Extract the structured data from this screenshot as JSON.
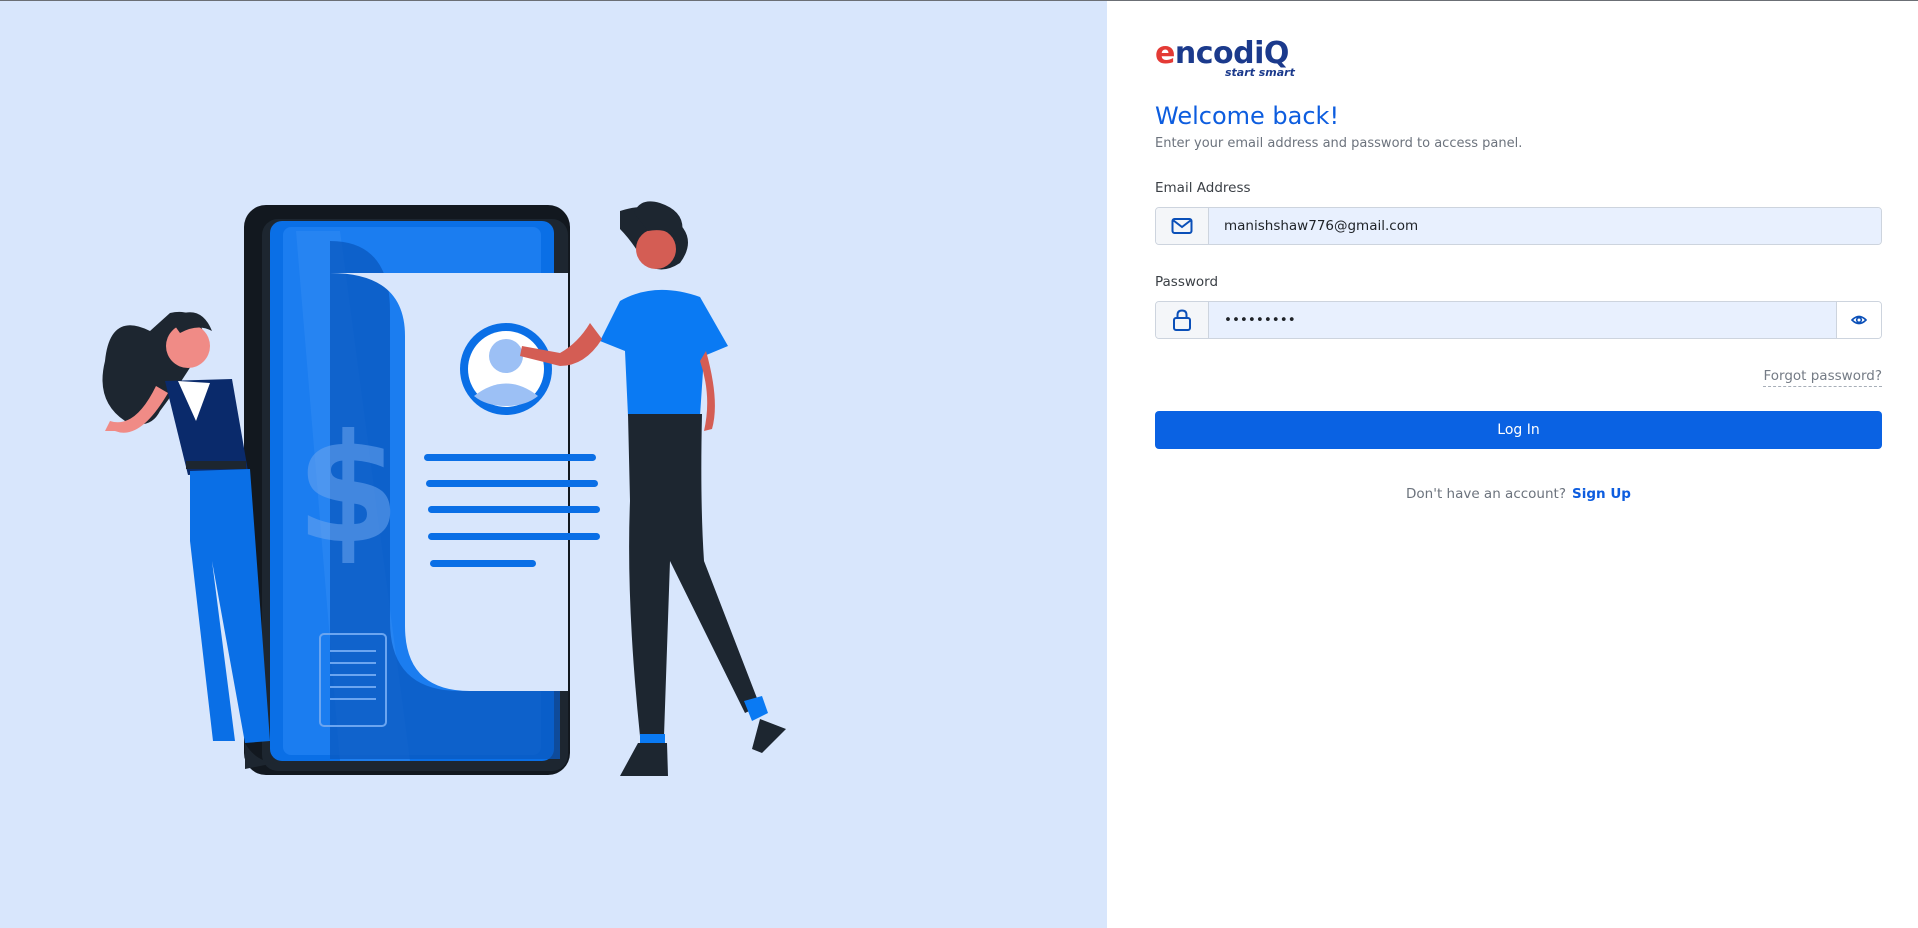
{
  "brand": {
    "logo_prefix": "e",
    "logo_rest": "ncodiQ",
    "tagline": "start smart"
  },
  "page": {
    "title": "Welcome back!",
    "subtitle": "Enter your email address and password to access panel."
  },
  "form": {
    "email_label": "Email Address",
    "email_value": "manishshaw776@gmail.com",
    "password_label": "Password",
    "password_value": "•••••••••",
    "forgot_label": "Forgot password?",
    "login_label": "Log In"
  },
  "signup": {
    "prompt": "Don't have an account?",
    "link_label": "Sign Up"
  },
  "colors": {
    "accent": "#0a62e3",
    "left_panel_bg": "#d8e6fc",
    "input_bg": "#e8f0fe",
    "logo_red": "#e43a35",
    "logo_navy": "#1b3a8c"
  },
  "icons": {
    "email_addon": "envelope-icon",
    "password_addon": "lock-icon",
    "toggle_visibility": "eye-icon"
  }
}
